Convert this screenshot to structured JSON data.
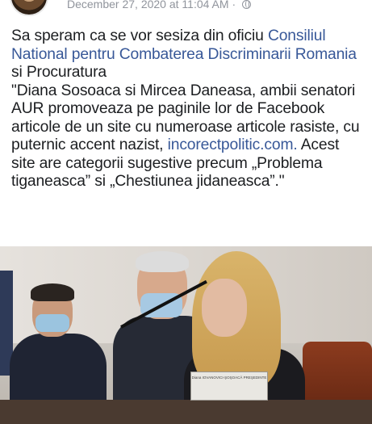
{
  "post": {
    "timestamp": "December 27, 2020 at 11:04 AM",
    "separator": "·",
    "privacy_icon": "globe-icon",
    "text": {
      "p1_a": "Sa speram ca se vor sesiza din oficiu ",
      "link1": "Consiliul National pentru Combaterea Discriminarii Romania",
      "p1_b": " si Procuratura",
      "p2_a": "\"Diana Sosoaca si Mircea Daneasa, ambii senatori AUR promoveaza pe paginile lor de Facebook articole de un site cu numeroase articole rasiste, cu puternic accent nazist, ",
      "link2": "incorectpolitic.com.",
      "p2_b": " Acest site are categorii sugestive precum „Problema tiganeasca” si „Chestiunea jidaneasca”.\""
    }
  },
  "photo": {
    "nameplate_text": "Diana IOVANOVICI-ŞOŞOACĂ PREŞEDINTE"
  },
  "colors": {
    "link": "#385898",
    "meta": "#90949c",
    "text": "#1c1e21"
  }
}
